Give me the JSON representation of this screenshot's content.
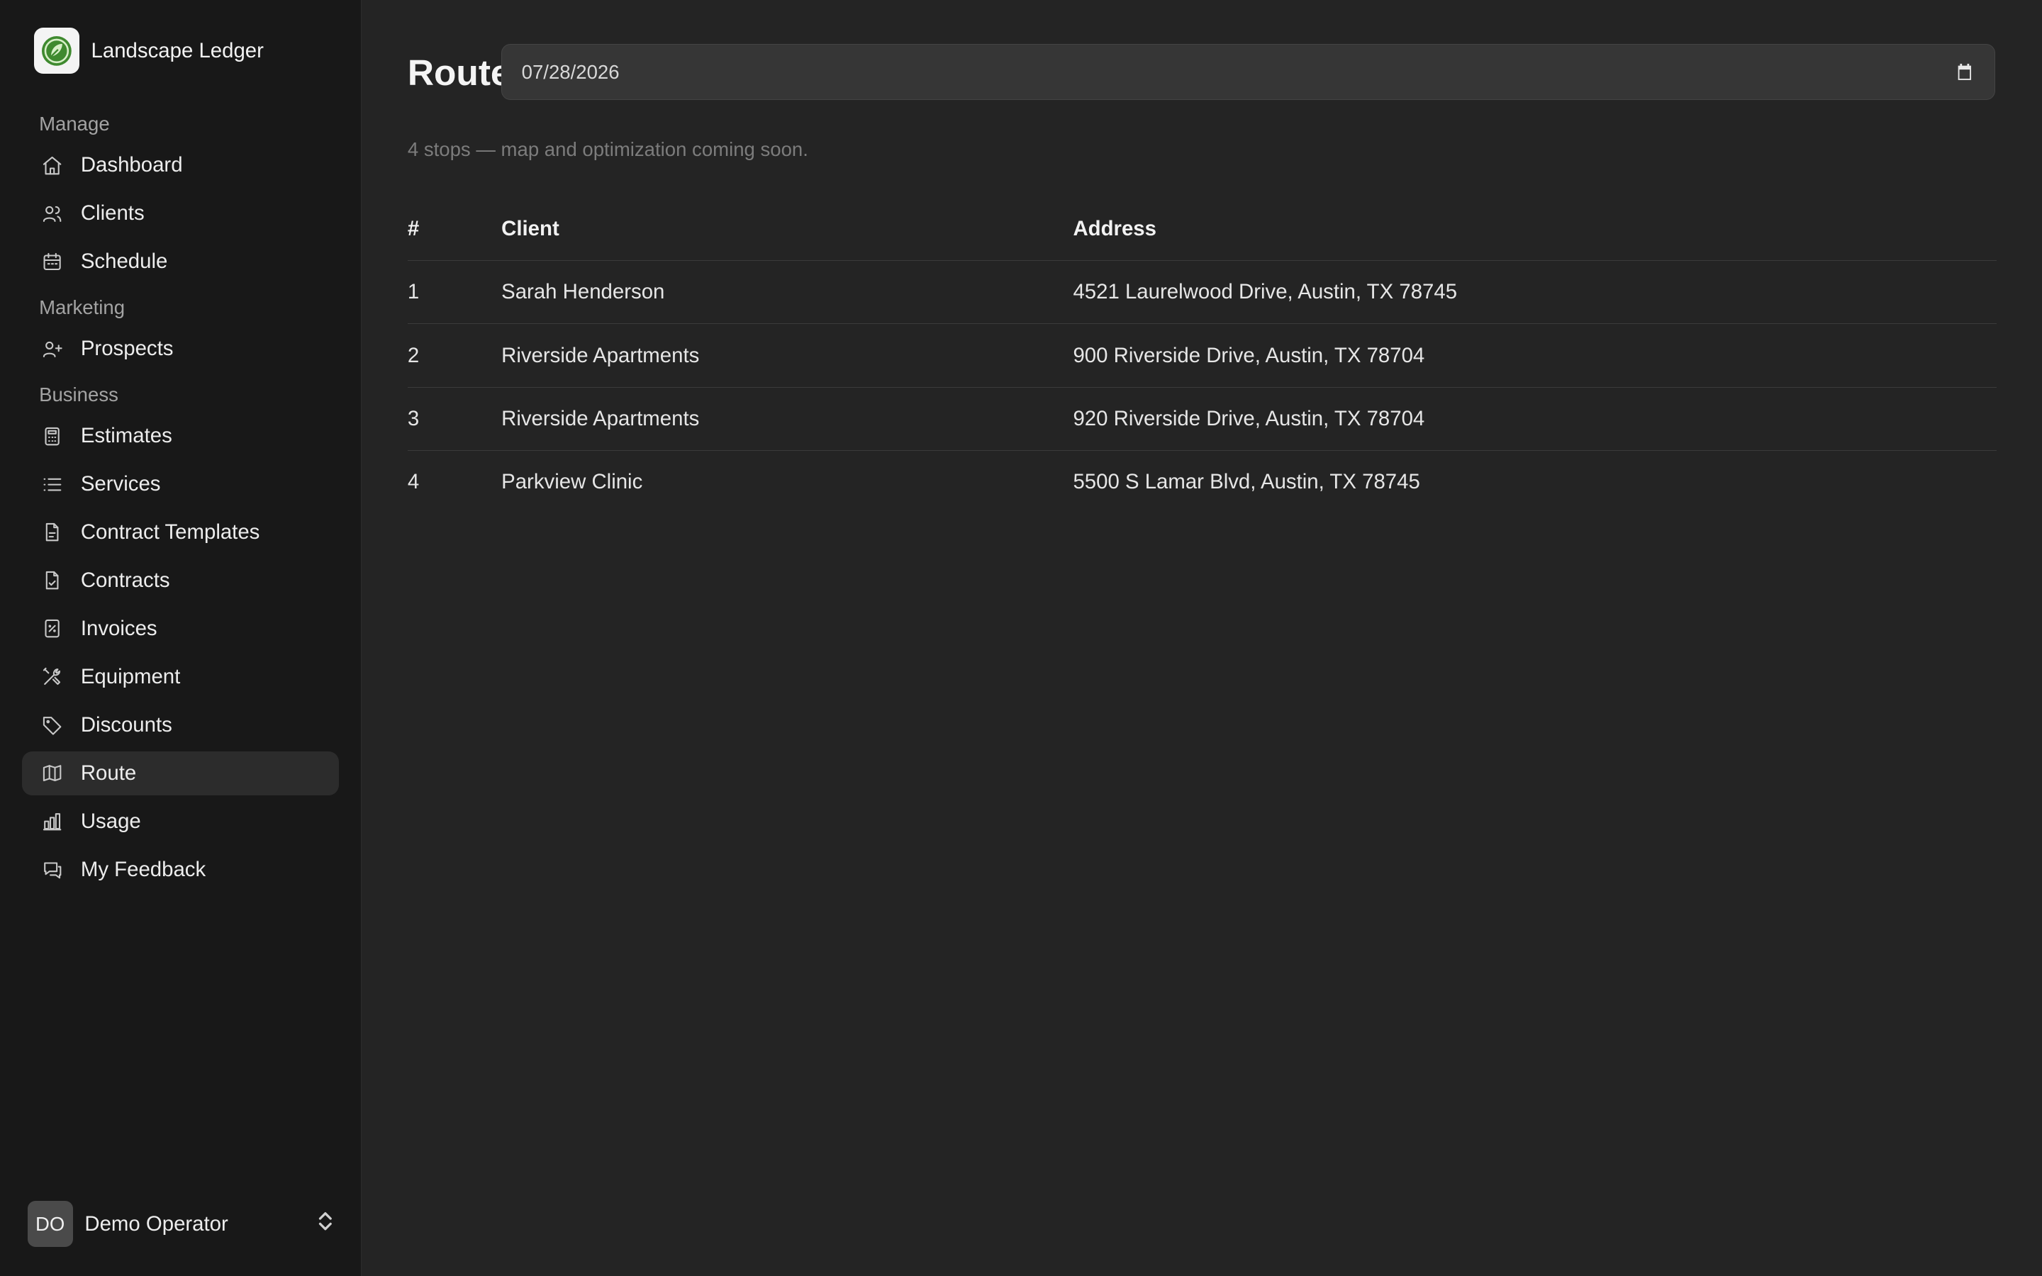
{
  "app": {
    "brand_name": "Landscape Ledger"
  },
  "sidebar": {
    "sections": [
      {
        "label": "Manage",
        "items": [
          {
            "label": "Dashboard",
            "icon": "home-icon"
          },
          {
            "label": "Clients",
            "icon": "users-icon"
          },
          {
            "label": "Schedule",
            "icon": "calendar-icon"
          }
        ]
      },
      {
        "label": "Marketing",
        "items": [
          {
            "label": "Prospects",
            "icon": "user-plus-icon"
          }
        ]
      },
      {
        "label": "Business",
        "items": [
          {
            "label": "Estimates",
            "icon": "calculator-icon"
          },
          {
            "label": "Services",
            "icon": "list-icon"
          },
          {
            "label": "Contract Templates",
            "icon": "file-text-icon"
          },
          {
            "label": "Contracts",
            "icon": "file-check-icon"
          },
          {
            "label": "Invoices",
            "icon": "receipt-icon"
          },
          {
            "label": "Equipment",
            "icon": "tools-icon"
          },
          {
            "label": "Discounts",
            "icon": "tag-icon"
          },
          {
            "label": "Route",
            "icon": "map-icon",
            "active": true
          },
          {
            "label": "Usage",
            "icon": "bar-chart-icon"
          },
          {
            "label": "My Feedback",
            "icon": "message-icon"
          }
        ]
      }
    ]
  },
  "user": {
    "initials": "DO",
    "name": "Demo Operator"
  },
  "page": {
    "title": "Route",
    "date_value": "07/28/2026",
    "subtitle": "4 stops — map and optimization coming soon."
  },
  "table": {
    "headers": [
      "#",
      "Client",
      "Address"
    ],
    "rows": [
      [
        "1",
        "Sarah Henderson",
        "4521 Laurelwood Drive, Austin, TX 78745"
      ],
      [
        "2",
        "Riverside Apartments",
        "900 Riverside Drive, Austin, TX 78704"
      ],
      [
        "3",
        "Riverside Apartments",
        "920 Riverside Drive, Austin, TX 78704"
      ],
      [
        "4",
        "Parkview Clinic",
        "5500 S Lamar Blvd, Austin, TX 78745"
      ]
    ]
  },
  "colors": {
    "sidebar_bg": "#181818",
    "main_bg": "#242424",
    "active_item_bg": "#2c2c2c",
    "brand_accent": "#3f8a2f"
  }
}
